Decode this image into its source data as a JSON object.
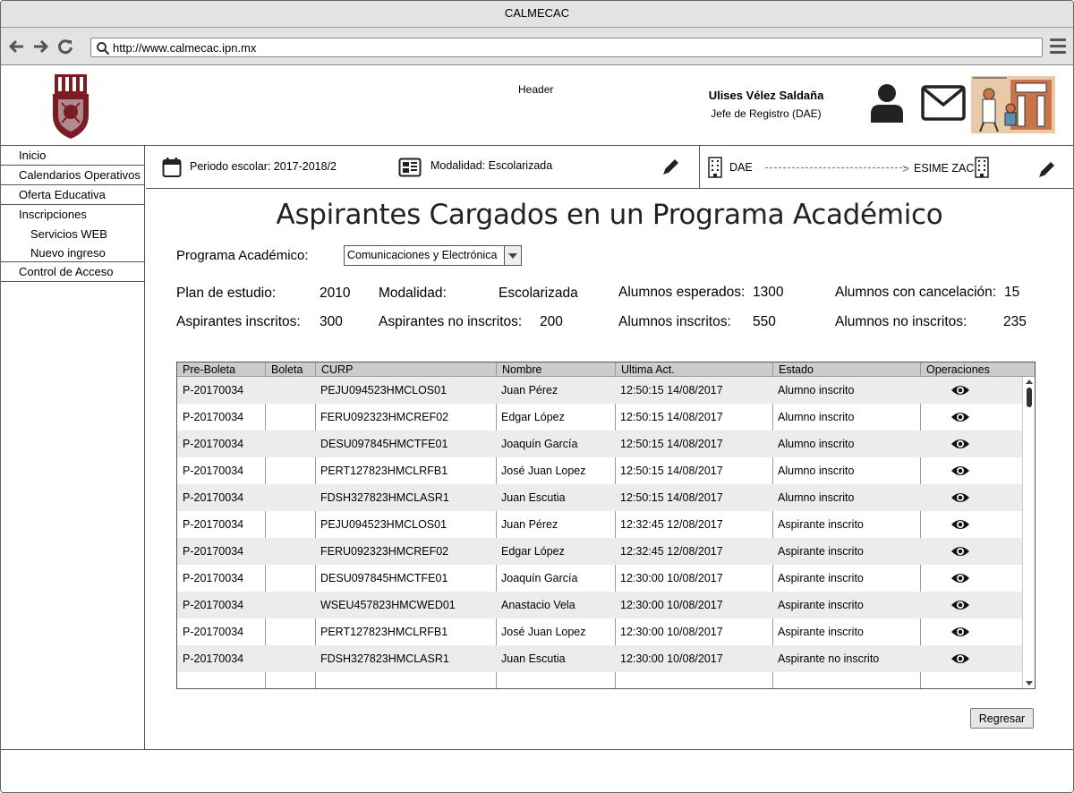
{
  "window": {
    "title": "CALMECAC"
  },
  "browser": {
    "url": "http://www.calmecac.ipn.mx"
  },
  "header": {
    "label": "Header",
    "user_name": "Ulises Vélez Saldaña",
    "user_role": "Jefe de Registro (DAE)"
  },
  "sidebar": {
    "items": [
      {
        "label": "Inicio"
      },
      {
        "label": "Calendarios Operativos"
      },
      {
        "label": "Oferta Educativa"
      },
      {
        "label": "Inscripciones"
      },
      {
        "label": "Servicios WEB"
      },
      {
        "label": "Nuevo ingreso"
      },
      {
        "label": "Control de Acceso"
      }
    ]
  },
  "infobar": {
    "periodo": "Periodo escolar: 2017-2018/2",
    "modalidad": "Modalidad: Escolarizada",
    "from": "DAE",
    "to": "ESIME ZAC"
  },
  "main": {
    "title": "Aspirantes Cargados en un Programa Académico",
    "programa_label": "Programa Académico:",
    "programa_value": "Comunicaciones y Electrónica",
    "stats": {
      "plan_label": "Plan de estudio:",
      "plan_value": "2010",
      "modalidad_label": "Modalidad:",
      "modalidad_value": "Escolarizada",
      "esperados_label": "Alumnos esperados:",
      "esperados_value": "1300",
      "cancelacion_label": "Alumnos con cancelación:",
      "cancelacion_value": "15",
      "asp_inscritos_label": "Aspirantes inscritos:",
      "asp_inscritos_value": "300",
      "asp_no_inscritos_label": "Aspirantes no inscritos:",
      "asp_no_inscritos_value": "200",
      "al_inscritos_label": "Alumnos inscritos:",
      "al_inscritos_value": "550",
      "al_no_inscritos_label": "Alumnos no inscritos:",
      "al_no_inscritos_value": "235"
    },
    "table": {
      "headers": [
        "Pre-Boleta",
        "Boleta",
        "CURP",
        "Nombre",
        "Ultima Act.",
        "Estado",
        "Operaciones"
      ],
      "rows": [
        [
          "P-20170034",
          "",
          "PEJU094523HMCLOS01",
          "Juan Pérez",
          "12:50:15 14/08/2017",
          "Alumno inscrito"
        ],
        [
          "P-20170034",
          "",
          "FERU092323HMCREF02",
          "Edgar López",
          "12:50:15 14/08/2017",
          "Alumno inscrito"
        ],
        [
          "P-20170034",
          "",
          "DESU097845HMCTFE01",
          "Joaquín García",
          "12:50:15 14/08/2017",
          "Alumno inscrito"
        ],
        [
          "P-20170034",
          "",
          "PERT127823HMCLRFB1",
          "José Juan Lopez",
          "12:50:15 14/08/2017",
          "Alumno inscrito"
        ],
        [
          "P-20170034",
          "",
          "FDSH327823HMCLASR1",
          "Juan Escutia",
          " 12:50:15 14/08/2017",
          "Alumno inscrito"
        ],
        [
          "P-20170034",
          "",
          "PEJU094523HMCLOS01",
          "Juan Pérez",
          "12:32:45 12/08/2017",
          "Aspirante inscrito"
        ],
        [
          "P-20170034",
          "",
          "FERU092323HMCREF02",
          "Edgar López",
          "12:32:45 12/08/2017",
          "Aspirante inscrito"
        ],
        [
          "P-20170034",
          "",
          "DESU097845HMCTFE01",
          "Joaquín García",
          "12:30:00 10/08/2017",
          "Aspirante inscrito"
        ],
        [
          "P-20170034",
          "",
          "WSEU457823HMCWED01",
          "Anastacio Vela",
          "12:30:00 10/08/2017",
          "Aspirante inscrito"
        ],
        [
          "P-20170034",
          "",
          "PERT127823HMCLRFB1",
          "José Juan Lopez",
          " 12:30:00 10/08/2017",
          "Aspirante inscrito"
        ],
        [
          "P-20170034",
          "",
          "FDSH327823HMCLASR1",
          "Juan Escutia",
          "12:30:00 10/08/2017",
          "Aspirante no inscrito"
        ]
      ]
    },
    "regresar_label": "Regresar"
  }
}
